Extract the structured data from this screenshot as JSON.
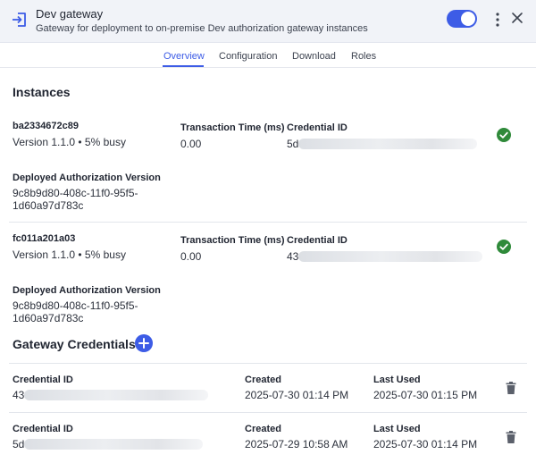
{
  "header": {
    "title": "Dev gateway",
    "subtitle": "Gateway for deployment to on-premise Dev authorization gateway instances",
    "enabled": true,
    "accent_color": "#3d5ce6"
  },
  "tabs": [
    {
      "label": "Overview",
      "active": true
    },
    {
      "label": "Configuration",
      "active": false
    },
    {
      "label": "Download",
      "active": false
    },
    {
      "label": "Roles",
      "active": false
    }
  ],
  "instances": {
    "title": "Instances",
    "transaction_time_label": "Transaction Time (ms)",
    "credential_id_label": "Credential ID",
    "deployed_version_label": "Deployed Authorization Version",
    "items": [
      {
        "id": "ba2334672c89",
        "version_status": "Version 1.1.0 • 5% busy",
        "transaction_time": "0.00",
        "credential_prefix": "5d",
        "deployed_version_line1": "9c8b9d80-408c-11f0-95f5-",
        "deployed_version_line2": "1d60a97d783c",
        "status_icon": "check-circle-icon"
      },
      {
        "id": "fc011a201a03",
        "version_status": "Version 1.1.0 • 5% busy",
        "transaction_time": "0.00",
        "credential_prefix": "43",
        "deployed_version_line1": "9c8b9d80-408c-11f0-95f5-",
        "deployed_version_line2": "1d60a97d783c",
        "status_icon": "check-circle-icon"
      }
    ]
  },
  "credentials": {
    "title": "Gateway Credentials",
    "credential_id_label": "Credential ID",
    "created_label": "Created",
    "last_used_label": "Last Used",
    "items": [
      {
        "credential_prefix": "43",
        "created": "2025-07-30 01:14 PM",
        "last_used": "2025-07-30 01:15 PM"
      },
      {
        "credential_prefix": "5d",
        "created": "2025-07-29 10:58 AM",
        "last_used": "2025-07-30 01:14 PM"
      }
    ]
  }
}
